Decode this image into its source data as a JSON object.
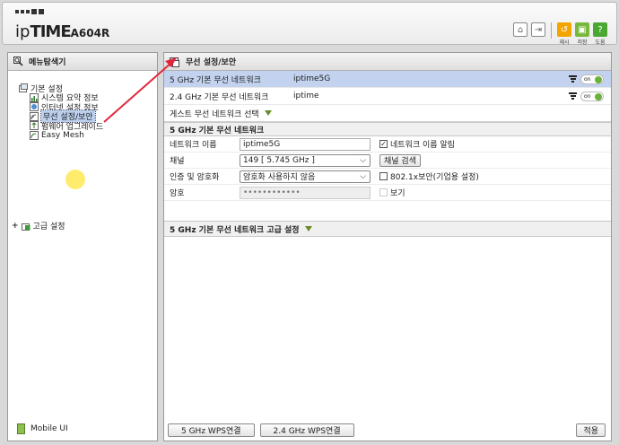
{
  "header": {
    "brand_ip": "ip",
    "brand_time": "TIME",
    "model": "A604R",
    "tools": [
      {
        "name": "home-icon",
        "label": ""
      },
      {
        "name": "logout-icon",
        "label": ""
      },
      {
        "name": "restart-icon",
        "label": "재시"
      },
      {
        "name": "save-icon",
        "label": "저장"
      },
      {
        "name": "help-icon",
        "label": "도움"
      }
    ],
    "tool_symbols": {
      "home": "⌂",
      "logout": "⇥",
      "restart": "↺",
      "save": "▣",
      "help": "?"
    }
  },
  "sidebar": {
    "title": "메뉴탐색기",
    "basic": {
      "label": "기본 설정",
      "items": [
        {
          "label": "시스템 요약 정보"
        },
        {
          "label": "인터넷 설정 정보"
        },
        {
          "label": "무선 설정/보안"
        },
        {
          "label": "펌웨어 업그레이드"
        },
        {
          "label": "Easy Mesh"
        }
      ]
    },
    "advanced": {
      "label": "고급 설정",
      "expander": "+"
    },
    "mobile": "Mobile UI"
  },
  "main": {
    "title": "무선 설정/보안",
    "networks": [
      {
        "name": "5 GHz 기본 무선 네트워크",
        "ssid": "iptime5G",
        "toggle": "on"
      },
      {
        "name": "2.4 GHz 기본 무선 네트워크",
        "ssid": "iptime",
        "toggle": "on"
      }
    ],
    "guest": "게스트 무선 네트워크 선택",
    "section_title": "5 GHz 기본 무선 네트워크",
    "form": {
      "network_name": {
        "label": "네트워크 이름",
        "value": "iptime5G",
        "broadcast_label": "네트워크 이름 알림",
        "broadcast_checked": "✓"
      },
      "channel": {
        "label": "채널",
        "value": "149 [ 5.745 GHz ]",
        "scan_button": "채널 검색"
      },
      "auth": {
        "label": "인증 및 암호화",
        "value": "암호화 사용하지 않음",
        "enterprise_label": "802.1x보안(기업용 설정)"
      },
      "password": {
        "label": "암호",
        "value": "••••••••••••",
        "show_label": "보기"
      }
    },
    "advanced_title": "5 GHz 기본 무선 네트워크 고급 설정",
    "buttons": {
      "wps5": "5 GHz WPS연결",
      "wps24": "2.4 GHz WPS연결",
      "apply": "적용"
    },
    "chevron": "⌵"
  },
  "colors": {
    "selected_row": "#c3d3ef",
    "toggle_on": "#6ab33a",
    "arrow": "#e0283c"
  }
}
